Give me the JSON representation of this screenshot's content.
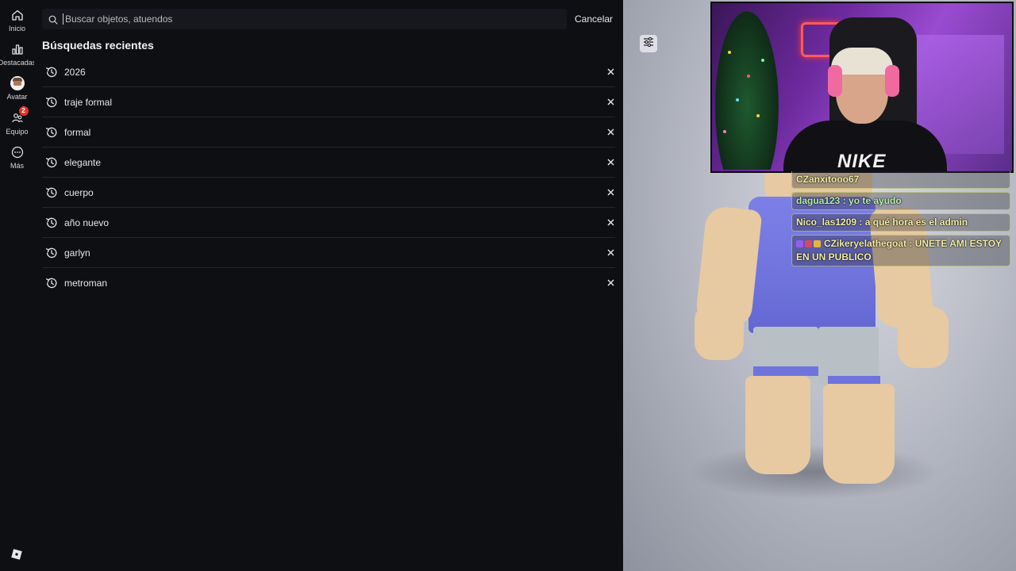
{
  "nav": {
    "items": [
      {
        "label": "Inicio",
        "icon": "home-icon"
      },
      {
        "label": "Destacadas",
        "icon": "chart-icon"
      },
      {
        "label": "Avatar",
        "icon": "avatar-icon"
      },
      {
        "label": "Equipo",
        "icon": "team-icon",
        "badge": "2"
      },
      {
        "label": "Más",
        "icon": "more-icon"
      }
    ],
    "logo": "roblox-logo-icon"
  },
  "search": {
    "placeholder": "Buscar objetos, atuendos",
    "value": "",
    "cancel_label": "Cancelar"
  },
  "recent": {
    "title": "Búsquedas recientes",
    "items": [
      {
        "text": "2026"
      },
      {
        "text": "traje formal"
      },
      {
        "text": "formal"
      },
      {
        "text": "elegante"
      },
      {
        "text": "cuerpo"
      },
      {
        "text": "año nuevo"
      },
      {
        "text": "garlyn"
      },
      {
        "text": "metroman"
      }
    ]
  },
  "viewport": {
    "filter_icon": "sliders-icon"
  },
  "webcam": {
    "shirt_text": "NIKE"
  },
  "chat": {
    "messages": [
      {
        "user": "CZanxitooo67",
        "text": "",
        "color": "#f6f0a8"
      },
      {
        "user": "dagua123",
        "text": " : yo te ayudo",
        "color": "#b8f3b0"
      },
      {
        "user": "Nico_las1209",
        "text": " : a qué hora es el admin",
        "color": "#f6f0a8"
      },
      {
        "user": "CZikeryelathegoat",
        "text": " : UNETE AMI ESTOY EN UN PUBLICO",
        "color": "#f6f0a8"
      }
    ]
  },
  "colors": {
    "background": "#0e0f13",
    "badge": "#e5322d"
  }
}
